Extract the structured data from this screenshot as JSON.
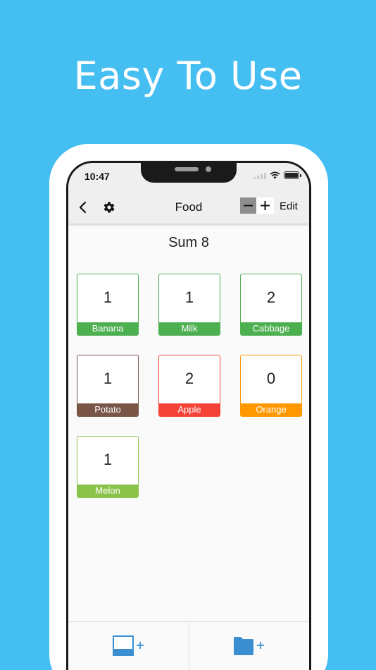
{
  "promo": {
    "headline": "Easy To Use"
  },
  "status_bar": {
    "time": "10:47"
  },
  "navbar": {
    "back_icon": "chevron-left-icon",
    "settings_icon": "gear-icon",
    "title": "Food",
    "minus_label": "−",
    "plus_label": "+",
    "edit_label": "Edit"
  },
  "summary": {
    "label": "Sum 8"
  },
  "items": [
    {
      "name": "Banana",
      "count": "1",
      "color": "#4CAF50"
    },
    {
      "name": "Milk",
      "count": "1",
      "color": "#4CAF50"
    },
    {
      "name": "Cabbage",
      "count": "2",
      "color": "#4CAF50"
    },
    {
      "name": "Potato",
      "count": "1",
      "color": "#795548"
    },
    {
      "name": "Apple",
      "count": "2",
      "color": "#F44336"
    },
    {
      "name": "Orange",
      "count": "0",
      "color": "#FF9800"
    },
    {
      "name": "Melon",
      "count": "1",
      "color": "#8BC34A"
    }
  ],
  "bottom_bar": {
    "add_item_icon": "add-item-icon",
    "add_item_plus": "+",
    "add_folder_icon": "add-folder-icon",
    "add_folder_plus": "+"
  },
  "colors": {
    "background": "#45BEF1",
    "accent": "#3B8FD1",
    "navbar": "#EFEFEF"
  }
}
